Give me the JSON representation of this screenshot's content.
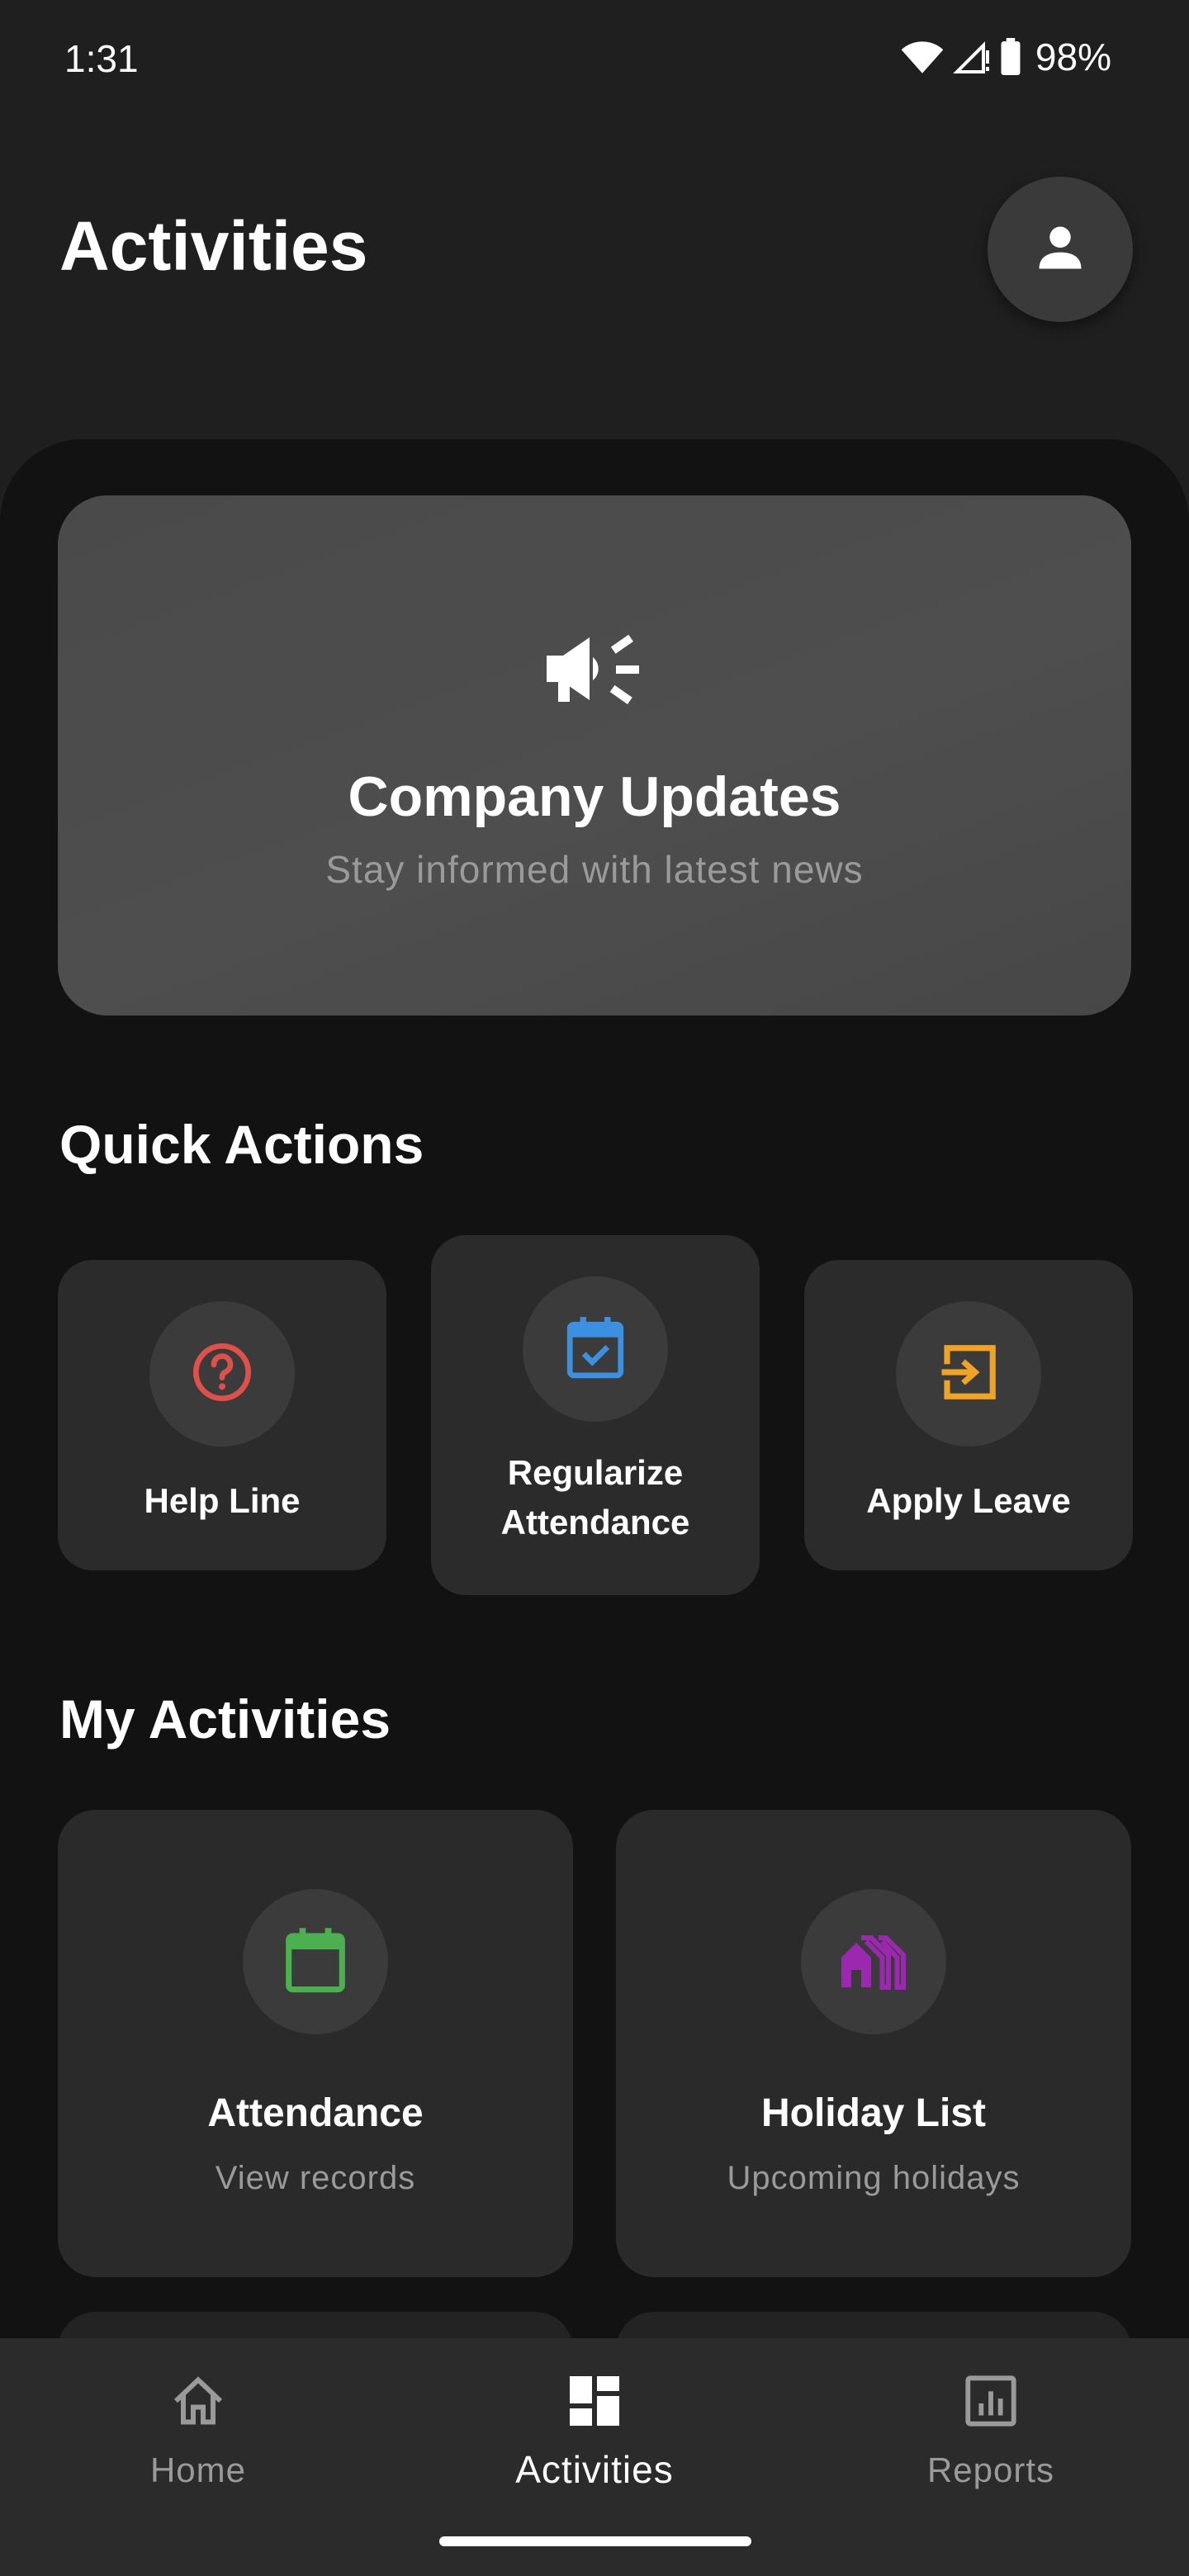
{
  "status_bar": {
    "time": "1:31",
    "battery": "98%",
    "icons": [
      "wifi-icon",
      "cell-signal-icon",
      "battery-icon"
    ]
  },
  "header": {
    "title": "Activities",
    "avatar_icon": "person-icon"
  },
  "company_updates": {
    "icon": "megaphone-icon",
    "title": "Company Updates",
    "subtitle": "Stay informed with latest news"
  },
  "quick_actions": {
    "title": "Quick Actions",
    "items": [
      {
        "label": "Help Line",
        "icon": "help-circle-icon",
        "color": "#e0504a"
      },
      {
        "label": "Regularize Attendance",
        "line1": "Regularize",
        "line2": "Attendance",
        "icon": "calendar-check-icon",
        "color": "#3d8fe0"
      },
      {
        "label": "Apply Leave",
        "icon": "login-box-icon",
        "color": "#f0a324"
      }
    ]
  },
  "my_activities": {
    "title": "My Activities",
    "items": [
      {
        "title": "Attendance",
        "subtitle": "View records",
        "icon": "calendar-icon",
        "color": "#4caf50"
      },
      {
        "title": "Holiday List",
        "subtitle": "Upcoming holidays",
        "icon": "holiday-village-icon",
        "color": "#9c27b0"
      }
    ]
  },
  "bottom_nav": {
    "items": [
      {
        "label": "Home",
        "icon": "home-icon",
        "active": false
      },
      {
        "label": "Activities",
        "icon": "dashboard-icon",
        "active": true
      },
      {
        "label": "Reports",
        "icon": "bar-chart-icon",
        "active": false
      }
    ]
  }
}
